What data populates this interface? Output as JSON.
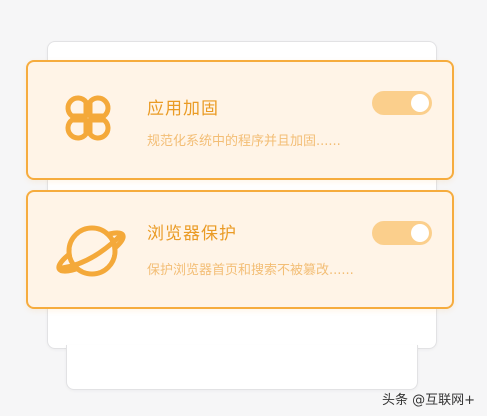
{
  "cards": [
    {
      "title": "应用加固",
      "description": "规范化系统中的程序并且加固......",
      "icon": "clover-icon",
      "toggle_on": true
    },
    {
      "title": "浏览器保护",
      "description": "保护浏览器首页和搜索不被篡改......",
      "icon": "planet-icon",
      "toggle_on": true
    }
  ],
  "watermark": "头条 @互联网+",
  "colors": {
    "accent": "#f6ac3e",
    "title": "#ea9b25",
    "description": "#f3be76",
    "card_bg": "#fff4e7",
    "toggle_bg": "#fbcf8c"
  }
}
